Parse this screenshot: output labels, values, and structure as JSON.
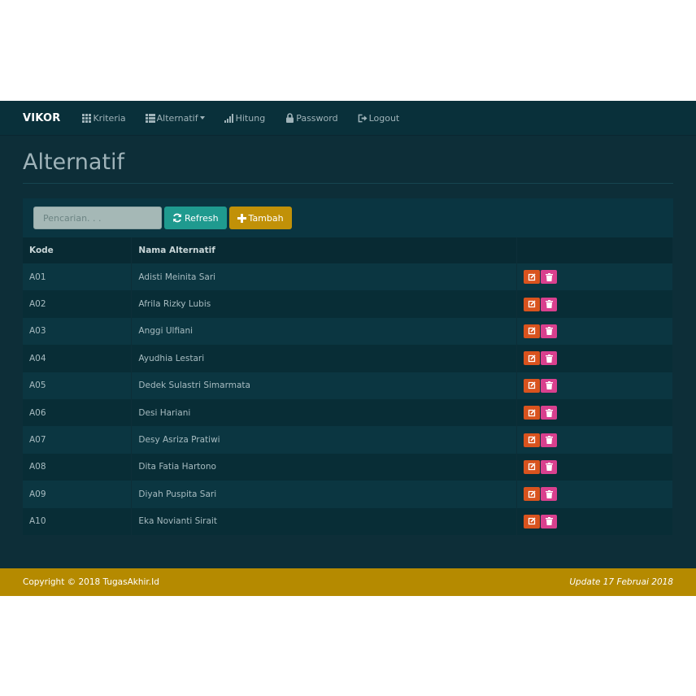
{
  "navbar": {
    "brand": "VIKOR",
    "items": [
      {
        "label": "Kriteria",
        "icon": "grid-icon"
      },
      {
        "label": "Alternatif",
        "icon": "list-icon",
        "dropdown": true
      },
      {
        "label": "Hitung",
        "icon": "signal-icon"
      },
      {
        "label": "Password",
        "icon": "lock-icon"
      },
      {
        "label": "Logout",
        "icon": "logout-icon"
      }
    ]
  },
  "page": {
    "title": "Alternatif"
  },
  "toolbar": {
    "search_placeholder": "Pencarian. . .",
    "refresh_label": "Refresh",
    "tambah_label": "Tambah"
  },
  "table": {
    "headers": [
      "Kode",
      "Nama Alternatif",
      ""
    ],
    "rows": [
      {
        "kode": "A01",
        "nama": "Adisti Meinita Sari"
      },
      {
        "kode": "A02",
        "nama": "Afrila Rizky Lubis"
      },
      {
        "kode": "A03",
        "nama": "Anggi Ulfiani"
      },
      {
        "kode": "A04",
        "nama": "Ayudhia Lestari"
      },
      {
        "kode": "A05",
        "nama": "Dedek Sulastri Simarmata"
      },
      {
        "kode": "A06",
        "nama": "Desi Hariani"
      },
      {
        "kode": "A07",
        "nama": "Desy Asriza Pratiwi"
      },
      {
        "kode": "A08",
        "nama": "Dita Fatia Hartono"
      },
      {
        "kode": "A09",
        "nama": "Diyah Puspita Sari"
      },
      {
        "kode": "A10",
        "nama": "Eka Novianti Sirait"
      }
    ],
    "row_actions": [
      "edit-icon",
      "trash-icon"
    ]
  },
  "footer": {
    "copyright": "Copyright © 2018 TugasAkhir.Id",
    "update": "Update 17 Februai 2018"
  },
  "colors": {
    "background": "#0d2e38",
    "navbar": "#09303a",
    "refresh_button": "#1f9a8f",
    "tambah_button": "#c19108",
    "edit_button": "#d9531e",
    "delete_button": "#d9408e",
    "footer": "#b58a00"
  }
}
